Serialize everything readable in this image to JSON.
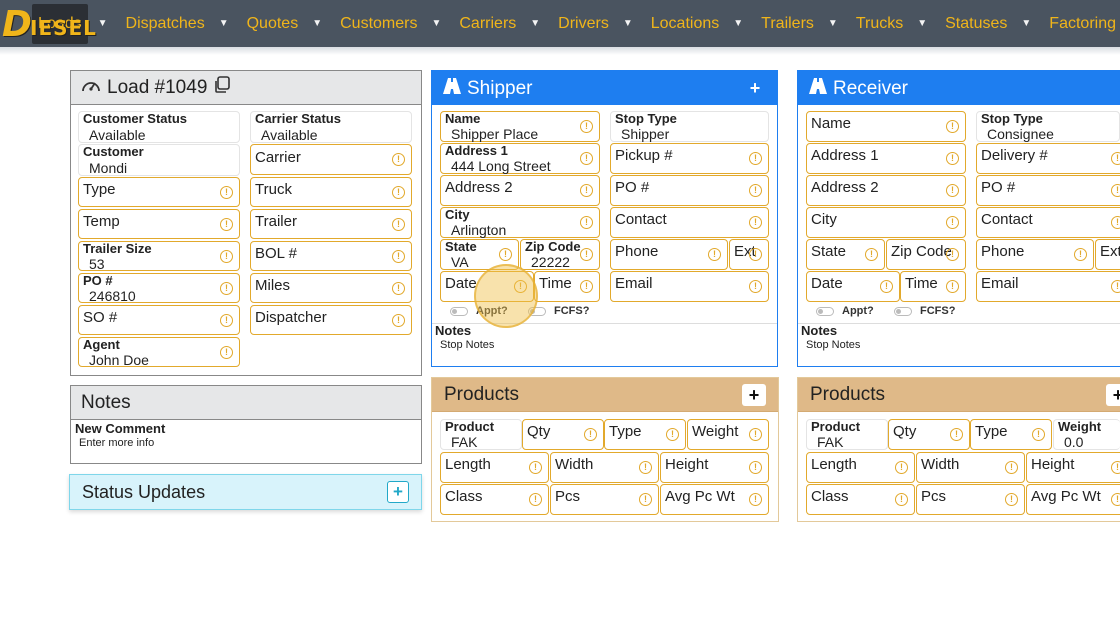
{
  "nav": {
    "logo_big": "D",
    "logo_rest": "IESEL",
    "items": [
      {
        "label": "Loads",
        "active": true
      },
      {
        "label": "Dispatches"
      },
      {
        "label": "Quotes"
      },
      {
        "label": "Customers"
      },
      {
        "label": "Carriers"
      },
      {
        "label": "Drivers"
      },
      {
        "label": "Locations"
      },
      {
        "label": "Trailers"
      },
      {
        "label": "Trucks"
      },
      {
        "label": "Statuses"
      },
      {
        "label": "Factoring"
      }
    ]
  },
  "load": {
    "title": "Load #1049",
    "customer_status_label": "Customer Status",
    "customer_status_value": "Available",
    "carrier_status_label": "Carrier Status",
    "carrier_status_value": "Available",
    "customer_label": "Customer",
    "customer_value": "Mondi",
    "carrier_label": "Carrier",
    "type_label": "Type",
    "truck_label": "Truck",
    "temp_label": "Temp",
    "trailer_label": "Trailer",
    "trailer_size_label": "Trailer Size",
    "trailer_size_value": "53",
    "bol_label": "BOL #",
    "po_label": "PO #",
    "po_value": "246810",
    "miles_label": "Miles",
    "so_label": "SO #",
    "dispatcher_label": "Dispatcher",
    "agent_label": "Agent",
    "agent_value": "John Doe"
  },
  "notes": {
    "title": "Notes",
    "new_comment_label": "New Comment",
    "new_comment_placeholder": "Enter more info"
  },
  "status_updates": {
    "title": "Status Updates",
    "plus": "+"
  },
  "shipper": {
    "title": "Shipper",
    "plus": "+",
    "name_label": "Name",
    "name_value": "Shipper Place",
    "stop_type_label": "Stop Type",
    "stop_type_value": "Shipper",
    "address1_label": "Address 1",
    "address1_value": "444 Long Street",
    "pickup_label": "Pickup #",
    "address2_label": "Address 2",
    "po_label": "PO #",
    "city_label": "City",
    "city_value": "Arlington",
    "contact_label": "Contact",
    "state_label": "State",
    "state_value": "VA",
    "zip_label": "Zip Code",
    "zip_value": "22222",
    "phone_label": "Phone",
    "ext_label": "Ext",
    "date_label": "Date",
    "time_label": "Time",
    "email_label": "Email",
    "appt_label": "Appt?",
    "fcfs_label": "FCFS?",
    "notes_label": "Notes",
    "notes_sub": "Stop Notes"
  },
  "receiver": {
    "title": "Receiver",
    "plus": "+",
    "name_label": "Name",
    "stop_type_label": "Stop Type",
    "stop_type_value": "Consignee",
    "address1_label": "Address 1",
    "delivery_label": "Delivery #",
    "address2_label": "Address 2",
    "po_label": "PO #",
    "city_label": "City",
    "contact_label": "Contact",
    "state_label": "State",
    "zip_label": "Zip Code",
    "phone_label": "Phone",
    "ext_label": "Ext",
    "date_label": "Date",
    "time_label": "Time",
    "email_label": "Email",
    "appt_label": "Appt?",
    "fcfs_label": "FCFS?",
    "notes_label": "Notes",
    "notes_sub": "Stop Notes"
  },
  "products_left": {
    "title": "Products",
    "plus": "+",
    "product_label": "Product",
    "product_value": "FAK",
    "qty_label": "Qty",
    "type_label": "Type",
    "weight_label": "Weight",
    "length_label": "Length",
    "width_label": "Width",
    "height_label": "Height",
    "class_label": "Class",
    "pcs_label": "Pcs",
    "avg_label": "Avg Pc Wt"
  },
  "products_right": {
    "title": "Products",
    "plus": "+",
    "product_label": "Product",
    "product_value": "FAK",
    "qty_label": "Qty",
    "type_label": "Type",
    "weight_label": "Weight",
    "weight_value": "0.0",
    "length_label": "Length",
    "width_label": "Width",
    "height_label": "Height",
    "class_label": "Class",
    "pcs_label": "Pcs",
    "avg_label": "Avg Pc Wt"
  }
}
